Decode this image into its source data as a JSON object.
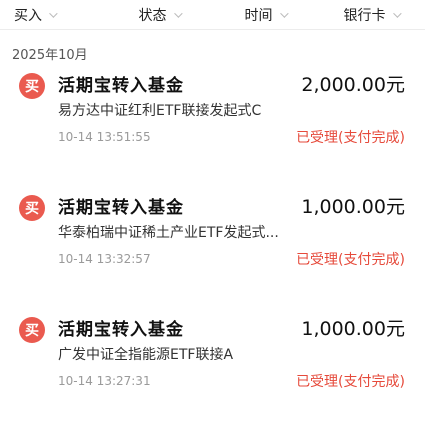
{
  "filters": [
    {
      "label": "买入"
    },
    {
      "label": "状态"
    },
    {
      "label": "时间"
    },
    {
      "label": "银行卡"
    }
  ],
  "month_label": "2025年10月",
  "records": [
    {
      "badge": "买",
      "title": "活期宝转入基金",
      "amount": "2,000.00元",
      "fund": "易方达中证红利ETF联接发起式C",
      "time": "10-14 13:51:55",
      "status": "已受理(支付完成)"
    },
    {
      "badge": "买",
      "title": "活期宝转入基金",
      "amount": "1,000.00元",
      "fund": "华泰柏瑞中证稀土产业ETF发起式...",
      "time": "10-14 13:32:57",
      "status": "已受理(支付完成)"
    },
    {
      "badge": "买",
      "title": "活期宝转入基金",
      "amount": "1,000.00元",
      "fund": "广发中证全指能源ETF联接A",
      "time": "10-14 13:27:31",
      "status": "已受理(支付完成)"
    }
  ]
}
